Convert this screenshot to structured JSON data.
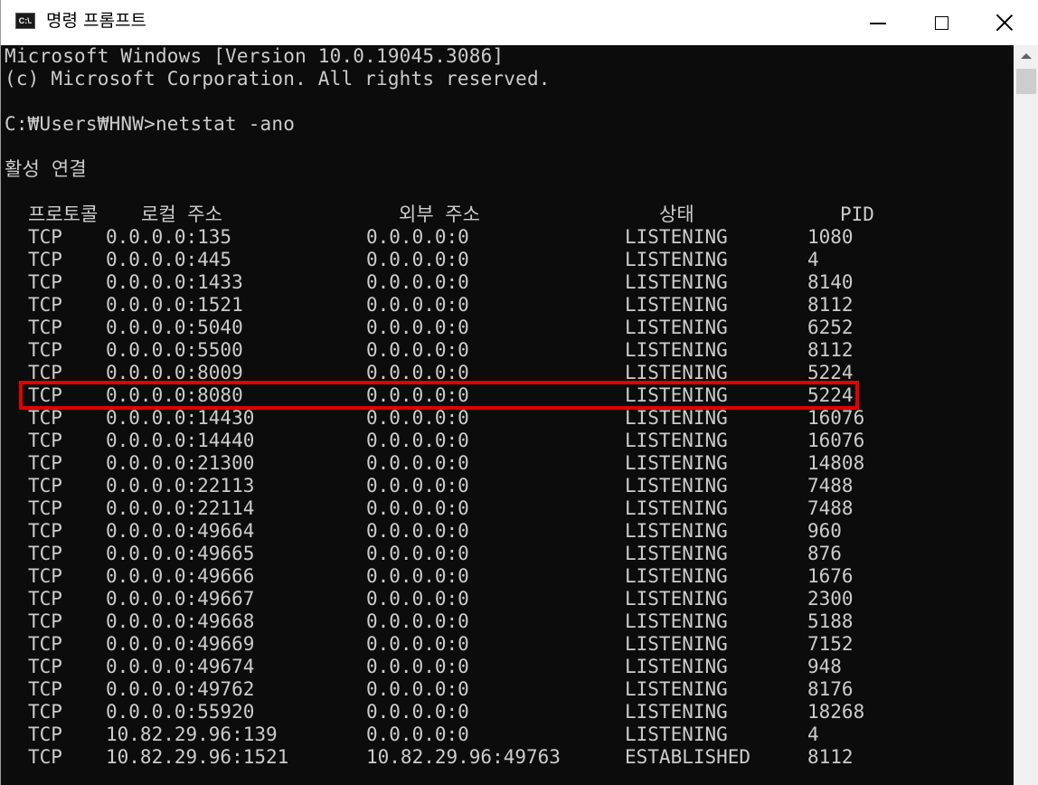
{
  "window": {
    "title": "명령 프롬프트",
    "app_icon_text": "C:\\."
  },
  "console": {
    "line_version": "Microsoft Windows [Version 10.0.19045.3086]",
    "line_copyright": "(c) Microsoft Corporation. All rights reserved.",
    "line_prompt": "C:₩Users₩HNW>netstat -ano",
    "line_section": "활성 연결"
  },
  "table": {
    "headers": {
      "protocol": "프로토콜",
      "local": "로컬 주소",
      "foreign": "외부 주소",
      "state": "상태",
      "pid": "PID"
    },
    "rows": [
      {
        "proto": "TCP",
        "local": "0.0.0.0:135",
        "foreign": "0.0.0.0:0",
        "state": "LISTENING",
        "pid": "1080"
      },
      {
        "proto": "TCP",
        "local": "0.0.0.0:445",
        "foreign": "0.0.0.0:0",
        "state": "LISTENING",
        "pid": "4"
      },
      {
        "proto": "TCP",
        "local": "0.0.0.0:1433",
        "foreign": "0.0.0.0:0",
        "state": "LISTENING",
        "pid": "8140"
      },
      {
        "proto": "TCP",
        "local": "0.0.0.0:1521",
        "foreign": "0.0.0.0:0",
        "state": "LISTENING",
        "pid": "8112"
      },
      {
        "proto": "TCP",
        "local": "0.0.0.0:5040",
        "foreign": "0.0.0.0:0",
        "state": "LISTENING",
        "pid": "6252"
      },
      {
        "proto": "TCP",
        "local": "0.0.0.0:5500",
        "foreign": "0.0.0.0:0",
        "state": "LISTENING",
        "pid": "8112"
      },
      {
        "proto": "TCP",
        "local": "0.0.0.0:8009",
        "foreign": "0.0.0.0:0",
        "state": "LISTENING",
        "pid": "5224"
      },
      {
        "proto": "TCP",
        "local": "0.0.0.0:8080",
        "foreign": "0.0.0.0:0",
        "state": "LISTENING",
        "pid": "5224"
      },
      {
        "proto": "TCP",
        "local": "0.0.0.0:14430",
        "foreign": "0.0.0.0:0",
        "state": "LISTENING",
        "pid": "16076"
      },
      {
        "proto": "TCP",
        "local": "0.0.0.0:14440",
        "foreign": "0.0.0.0:0",
        "state": "LISTENING",
        "pid": "16076"
      },
      {
        "proto": "TCP",
        "local": "0.0.0.0:21300",
        "foreign": "0.0.0.0:0",
        "state": "LISTENING",
        "pid": "14808"
      },
      {
        "proto": "TCP",
        "local": "0.0.0.0:22113",
        "foreign": "0.0.0.0:0",
        "state": "LISTENING",
        "pid": "7488"
      },
      {
        "proto": "TCP",
        "local": "0.0.0.0:22114",
        "foreign": "0.0.0.0:0",
        "state": "LISTENING",
        "pid": "7488"
      },
      {
        "proto": "TCP",
        "local": "0.0.0.0:49664",
        "foreign": "0.0.0.0:0",
        "state": "LISTENING",
        "pid": "960"
      },
      {
        "proto": "TCP",
        "local": "0.0.0.0:49665",
        "foreign": "0.0.0.0:0",
        "state": "LISTENING",
        "pid": "876"
      },
      {
        "proto": "TCP",
        "local": "0.0.0.0:49666",
        "foreign": "0.0.0.0:0",
        "state": "LISTENING",
        "pid": "1676"
      },
      {
        "proto": "TCP",
        "local": "0.0.0.0:49667",
        "foreign": "0.0.0.0:0",
        "state": "LISTENING",
        "pid": "2300"
      },
      {
        "proto": "TCP",
        "local": "0.0.0.0:49668",
        "foreign": "0.0.0.0:0",
        "state": "LISTENING",
        "pid": "5188"
      },
      {
        "proto": "TCP",
        "local": "0.0.0.0:49669",
        "foreign": "0.0.0.0:0",
        "state": "LISTENING",
        "pid": "7152"
      },
      {
        "proto": "TCP",
        "local": "0.0.0.0:49674",
        "foreign": "0.0.0.0:0",
        "state": "LISTENING",
        "pid": "948"
      },
      {
        "proto": "TCP",
        "local": "0.0.0.0:49762",
        "foreign": "0.0.0.0:0",
        "state": "LISTENING",
        "pid": "8176"
      },
      {
        "proto": "TCP",
        "local": "0.0.0.0:55920",
        "foreign": "0.0.0.0:0",
        "state": "LISTENING",
        "pid": "18268"
      },
      {
        "proto": "TCP",
        "local": "10.82.29.96:139",
        "foreign": "0.0.0.0:0",
        "state": "LISTENING",
        "pid": "4"
      },
      {
        "proto": "TCP",
        "local": "10.82.29.96:1521",
        "foreign": "10.82.29.96:49763",
        "state": "ESTABLISHED",
        "pid": "8112"
      }
    ],
    "highlighted_row_index": 7
  },
  "colors": {
    "console_bg": "#0c0c0c",
    "console_text": "#cccccc",
    "highlight_border": "#e00000",
    "titlebar_bg": "#ffffff"
  },
  "icons": {
    "minimize": "minimize-icon",
    "maximize": "maximize-icon",
    "close": "close-icon",
    "app": "cmd-app-icon",
    "scroll_up": "arrow-up-icon"
  }
}
